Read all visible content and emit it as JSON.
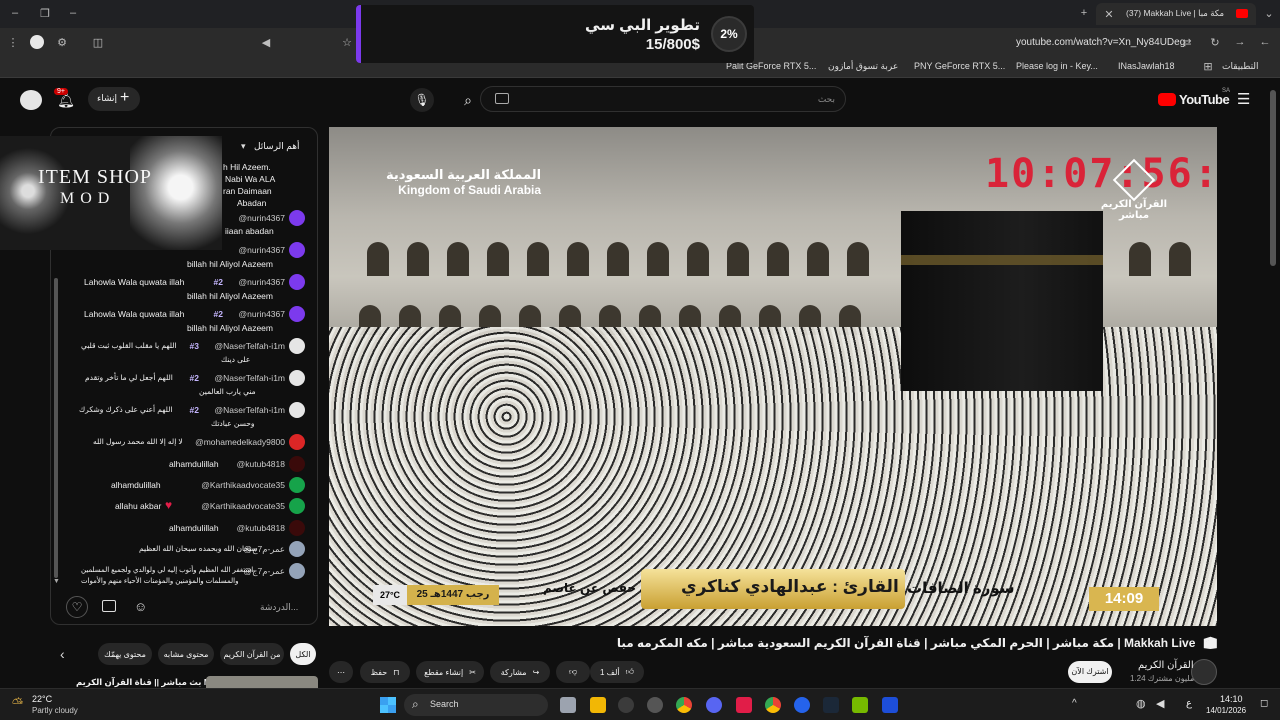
{
  "browser": {
    "tab_title": "(37) Makkah Live | مكة مبا",
    "url": "youtube.com/watch?v=Xn_Ny84UDeg",
    "bookmarks": [
      "التطبيقات",
      "INasJawlah18",
      "Please log in - Key...",
      "PNY GeForce RTX 5...",
      "عربة تسوق أمازون",
      "Palit GeForce RTX 5..."
    ]
  },
  "overlay": {
    "title": "تطوير البي سي",
    "amount": "15/800$",
    "percent": "2%"
  },
  "youtube": {
    "logo_text": "YouTube",
    "country": "SA",
    "search_placeholder": "بحث",
    "create_label": "إنشاء",
    "notif_count": "9+"
  },
  "chat": {
    "header": "أهم الرسائل",
    "input_placeholder": "الدردشة...",
    "logo_line1": "ITEM SHOP",
    "logo_line2": "MOD",
    "partial_lines": [
      "h Hil Azeem.",
      "Nabi Wa ALA",
      "ran Daimaan",
      "Abadan",
      "iiaan abadan"
    ],
    "messages": [
      {
        "user": "@nurin4367",
        "badge": "",
        "text": "iiaan abadan"
      },
      {
        "user": "@nurin4367",
        "badge": "",
        "text": "billah hil Aliyol Aazeem"
      },
      {
        "user": "@nurin4367",
        "badge": "#2",
        "text": "Lahowla Wala quwata illah",
        "text2": "billah hil Aliyol Aazeem"
      },
      {
        "user": "@nurin4367",
        "badge": "#2",
        "text": "Lahowla Wala quwata illah",
        "text2": "billah hil Aliyol Aazeem"
      },
      {
        "user": "@NaserTelfah-i1m",
        "badge": "#3",
        "text": "اللهم يا مقلب القلوب ثبت قلبي",
        "text2": "على دينك"
      },
      {
        "user": "@NaserTelfah-i1m",
        "badge": "#2",
        "text": "اللهم أجعل لي ما تأخر وتقدم",
        "text2": "مني يارب العالمين"
      },
      {
        "user": "@NaserTelfah-i1m",
        "badge": "#2",
        "text": "اللهم أعني على ذكرك وشكرك",
        "text2": "وحسن عبادتك"
      },
      {
        "user": "@mohamedelkady9800",
        "badge": "",
        "text": "لا إله إلا الله محمد رسول الله"
      },
      {
        "user": "@kutub4818",
        "badge": "",
        "text": "alhamdulillah"
      },
      {
        "user": "@Karthikaadvocate35",
        "badge": "",
        "text": "alhamdulillah"
      },
      {
        "user": "@Karthikaadvocate35",
        "badge": "",
        "text": "allahu akbar"
      },
      {
        "user": "@kutub4818",
        "badge": "",
        "text": "alhamdulillah"
      },
      {
        "user": "@عمر-م7ج",
        "badge": "",
        "text": "سبحان الله وبحمده سبحان الله العظيم"
      },
      {
        "user": "@عمر-م7ج",
        "badge": "",
        "text": "استغفر الله العظيم وأتوب إليه لي ولوالدي ولجميع المسلمين",
        "text2": "والمسلمات والمؤمنين والمؤمنات الأحياء منهم والأموات"
      }
    ]
  },
  "video": {
    "clock": "10:07:56:57",
    "watermark_line1": "القرآن الكريم",
    "watermark_line2": "مباشر",
    "ksa_ar": "المملكة العربية السعودية",
    "ksa_en": "Kingdom of Saudi Arabia",
    "temp": "27°C",
    "hijri": "25 رجب 1447هـ",
    "riwaya": "رواية حفص عن عاصم",
    "reciter": "القارئ : عبدالهادي كناكري",
    "surah": "سورة الصافات",
    "time": "14:09"
  },
  "below": {
    "title": "مكة مباشر | الحرم المكي مباشر | قناة القرآن الكريم السعودية مباشر | مكه المكرمه مبا | Makkah Live",
    "channel": "القرآن الكريم",
    "subs": "1.24 مليون مشترك",
    "subscribe": "اشترك الآن",
    "likes": "1 ألف",
    "share": "مشاركة",
    "clip": "إنشاء مقطع",
    "save": "حفظ",
    "chips": [
      "الكل",
      "من القرآن الكريم",
      "محتوى مشابه",
      "محتوى يهمّك"
    ],
    "rec_title": "بث مباشر || قناة القرآن الكريم Makkah"
  },
  "taskbar": {
    "weather_temp": "22°C",
    "weather_desc": "Partly cloudy",
    "search": "Search",
    "time": "14:10",
    "date": "14/01/2026",
    "lang": "ع"
  }
}
